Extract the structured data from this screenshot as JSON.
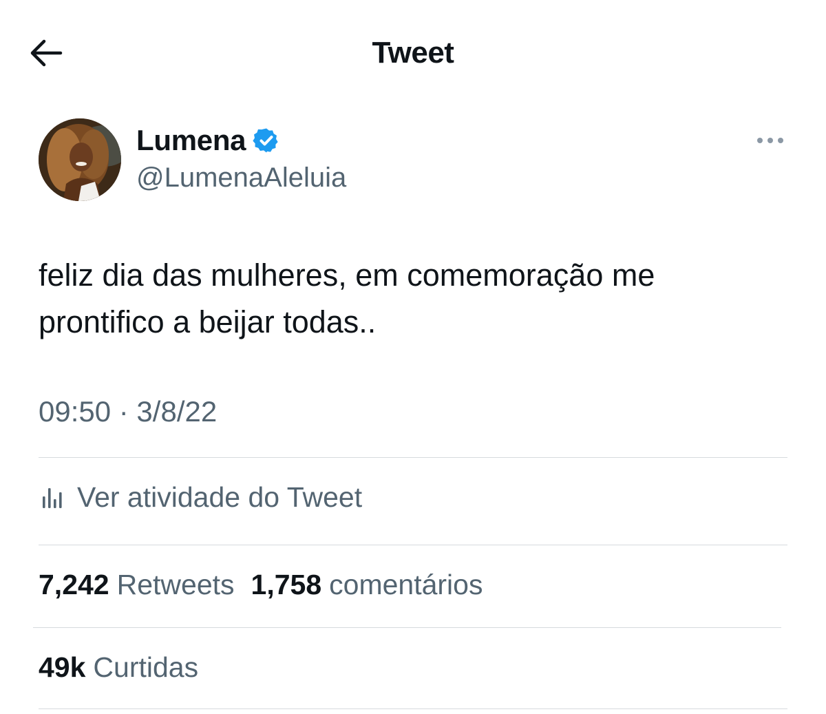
{
  "header": {
    "title": "Tweet",
    "back_icon": "arrow-left-icon"
  },
  "author": {
    "display_name": "Lumena",
    "handle": "@LumenaAleluia",
    "verified": true,
    "verified_color": "#1d9bf0"
  },
  "tweet": {
    "text": "feliz dia das mulheres, em comemoração me prontifico a beijar todas..",
    "timestamp": "09:50 · 3/8/22"
  },
  "activity": {
    "label": "Ver atividade do Tweet",
    "icon": "analytics-bars-icon"
  },
  "stats": {
    "retweets_count": "7,242",
    "retweets_label": "Retweets",
    "comments_count": "1,758",
    "comments_label": "comentários",
    "likes_count": "49k",
    "likes_label": "Curtidas"
  },
  "colors": {
    "text_primary": "#0f1419",
    "text_secondary": "#536471",
    "divider": "#d6dadd",
    "accent": "#1d9bf0"
  }
}
